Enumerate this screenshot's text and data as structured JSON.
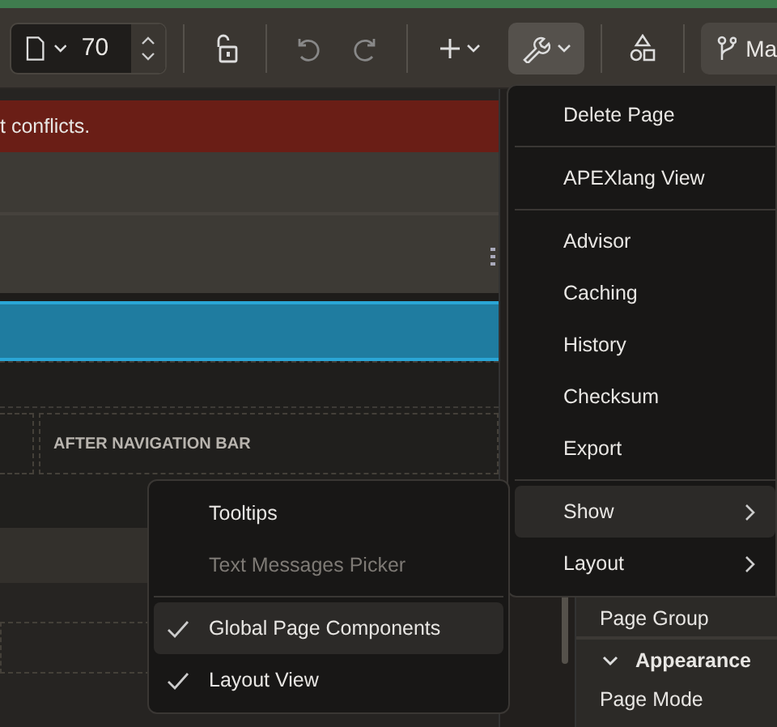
{
  "toolbar": {
    "page_number": "70",
    "wrench_button": {
      "expanded": true
    },
    "branch_button": {
      "label": "Ma"
    }
  },
  "alert": {
    "text": "t conflicts."
  },
  "layout": {
    "region_label": "AFTER NAVIGATION BAR"
  },
  "properties": {
    "items": [
      {
        "kind": "label",
        "text": "Page Group"
      },
      {
        "kind": "section",
        "text": "Appearance",
        "expanded": true
      },
      {
        "kind": "label",
        "text": "Page Mode"
      }
    ]
  },
  "menu": {
    "items": [
      {
        "kind": "item",
        "label": "Delete Page",
        "selected": false,
        "submenu": false
      },
      {
        "kind": "separator"
      },
      {
        "kind": "item",
        "label": "APEXlang View",
        "selected": false,
        "submenu": false
      },
      {
        "kind": "separator"
      },
      {
        "kind": "item",
        "label": "Advisor",
        "selected": false,
        "submenu": false
      },
      {
        "kind": "item",
        "label": "Caching",
        "selected": false,
        "submenu": false
      },
      {
        "kind": "item",
        "label": "History",
        "selected": false,
        "submenu": false
      },
      {
        "kind": "item",
        "label": "Checksum",
        "selected": false,
        "submenu": false
      },
      {
        "kind": "item",
        "label": "Export",
        "selected": false,
        "submenu": false
      },
      {
        "kind": "separator"
      },
      {
        "kind": "item",
        "label": "Show",
        "selected": true,
        "submenu": true
      },
      {
        "kind": "item",
        "label": "Layout",
        "selected": false,
        "submenu": true
      }
    ]
  },
  "submenu": {
    "items": [
      {
        "kind": "item",
        "label": "Tooltips",
        "checked": false,
        "disabled": false,
        "selected": false
      },
      {
        "kind": "item",
        "label": "Text Messages Picker",
        "checked": false,
        "disabled": true,
        "selected": false
      },
      {
        "kind": "separator"
      },
      {
        "kind": "item",
        "label": "Global Page Components",
        "checked": true,
        "disabled": false,
        "selected": true
      },
      {
        "kind": "item",
        "label": "Layout View",
        "checked": true,
        "disabled": false,
        "selected": false
      }
    ]
  }
}
